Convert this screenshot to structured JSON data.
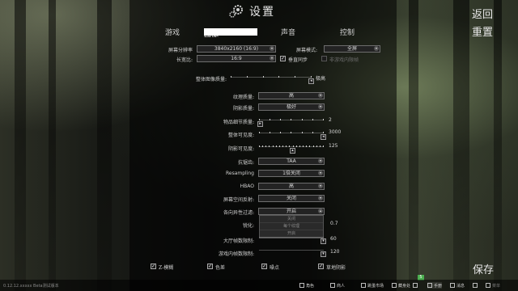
{
  "header": {
    "title": "设置",
    "back_label": "返回",
    "reset_label": "重置"
  },
  "tabs": [
    {
      "label": "游戏"
    },
    {
      "label": "图像"
    },
    {
      "label": "声音"
    },
    {
      "label": "控制"
    }
  ],
  "settings": {
    "resolution": {
      "label": "屏幕分辨率",
      "value": "3840x2160 (16:9)"
    },
    "screen_mode": {
      "label": "屏幕模式:",
      "value": "全屏"
    },
    "aspect": {
      "label": "长宽比:",
      "value": "16:9"
    },
    "vsync": {
      "label": "垂直同步",
      "checked": true
    },
    "other_check": {
      "label": "非游戏内限帧",
      "checked": false
    },
    "overall_quality": {
      "label": "整体图像质量:",
      "value": "极高",
      "level": 1.0
    },
    "texture_quality": {
      "label": "纹理质量:",
      "value": "高"
    },
    "shadow_quality": {
      "label": "阴影质量:",
      "value": "极好"
    },
    "object_lod": {
      "label": "物品细节质量:",
      "value": "2",
      "level": 0.0
    },
    "overall_visibility": {
      "label": "整体可见度:",
      "value": "3000",
      "level": 1.0
    },
    "shadow_visibility": {
      "label": "阴影可见度:",
      "value": "125",
      "level": 0.5
    },
    "antialiasing": {
      "label": "抗锯齿:",
      "value": "TAA"
    },
    "resampling": {
      "label": "Resampling",
      "value": "1倍关闭"
    },
    "hbao": {
      "label": "HBAO",
      "value": "高"
    },
    "ssr": {
      "label": "屏幕空间反射:",
      "value": "关闭"
    },
    "anisotropic": {
      "label": "各向异性过滤:",
      "value": "开启",
      "options": [
        "关闭",
        "每个纹理",
        "开启"
      ]
    },
    "sharpen": {
      "label": "锐化:",
      "value": "0.7"
    },
    "lobby_fps": {
      "label": "大厅帧数限制:",
      "value": "60"
    },
    "game_fps": {
      "label": "游戏内帧数限制:",
      "value": "120"
    }
  },
  "bottom_checks": [
    {
      "label": "Z-模糊",
      "checked": true
    },
    {
      "label": "色差",
      "checked": true
    },
    {
      "label": "噪点",
      "checked": true
    },
    {
      "label": "草地阴影",
      "checked": true
    }
  ],
  "save_label": "保存",
  "version": "0.12.12.xxxxx Beta测试版本",
  "taskbar": [
    {
      "label": "角色",
      "icon": "character-icon"
    },
    {
      "label": "商人",
      "icon": "trader-icon"
    },
    {
      "label": "跳蚤市场",
      "icon": "flea-market-icon"
    },
    {
      "label": "藏身处",
      "icon": "hideout-icon"
    },
    {
      "label": "背包",
      "icon": "backpack-icon"
    },
    {
      "label": "手册",
      "icon": "handbook-icon"
    },
    {
      "label": "消息",
      "icon": "messages-icon"
    },
    {
      "label": "好友",
      "icon": "friends-icon"
    },
    {
      "label": "菜单",
      "icon": "menu-icon"
    }
  ],
  "notification_count": "5"
}
